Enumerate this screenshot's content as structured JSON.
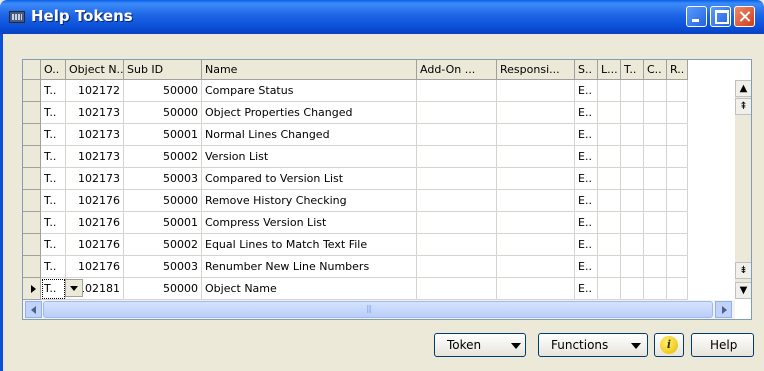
{
  "window": {
    "title": "Help Tokens"
  },
  "grid": {
    "columns": [
      "O..",
      "Object N...",
      "Sub ID",
      "Name",
      "Add-On ...",
      "Responsi...",
      "S..",
      "L...",
      "T..",
      "C..",
      "R.."
    ],
    "rows": [
      {
        "type": "T..",
        "object_no": "102172",
        "sub_id": "50000",
        "name": "Compare Status",
        "s": "E.."
      },
      {
        "type": "T..",
        "object_no": "102173",
        "sub_id": "50000",
        "name": "Object Properties Changed",
        "s": "E.."
      },
      {
        "type": "T..",
        "object_no": "102173",
        "sub_id": "50001",
        "name": "Normal Lines Changed",
        "s": "E.."
      },
      {
        "type": "T..",
        "object_no": "102173",
        "sub_id": "50002",
        "name": "Version List",
        "s": "E.."
      },
      {
        "type": "T..",
        "object_no": "102173",
        "sub_id": "50003",
        "name": "Compared to Version List",
        "s": "E.."
      },
      {
        "type": "T..",
        "object_no": "102176",
        "sub_id": "50000",
        "name": "Remove History Checking",
        "s": "E.."
      },
      {
        "type": "T..",
        "object_no": "102176",
        "sub_id": "50001",
        "name": "Compress Version List",
        "s": "E.."
      },
      {
        "type": "T..",
        "object_no": "102176",
        "sub_id": "50002",
        "name": "Equal Lines to Match Text File",
        "s": "E.."
      },
      {
        "type": "T..",
        "object_no": "102176",
        "sub_id": "50003",
        "name": "Renumber New Line Numbers",
        "s": "E.."
      },
      {
        "type": "T..",
        "object_no": "102181",
        "sub_id": "50000",
        "name": "Object Name",
        "s": "E.."
      }
    ],
    "active_row": 9
  },
  "buttons": {
    "token": "Token",
    "functions": "Functions",
    "info": "i",
    "help": "Help"
  },
  "icons": {
    "window": "form-icon",
    "info": "info-icon"
  },
  "colors": {
    "titlebar": "#0A50D8",
    "selection_arrow": "#000000"
  }
}
